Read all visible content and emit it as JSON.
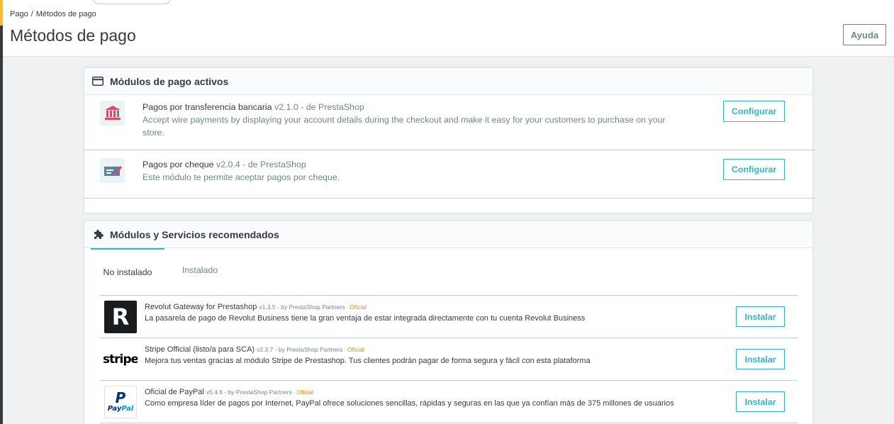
{
  "breadcrumb": {
    "items": [
      "Pago",
      "Métodos de pago"
    ],
    "separator": "/"
  },
  "page": {
    "title": "Métodos de pago",
    "help_label": "Ayuda"
  },
  "active_modules": {
    "title": "Módulos de pago activos",
    "icon": "credit-card-icon",
    "items": [
      {
        "name": "Pagos por transferencia bancaria",
        "version": "v2.1.0 - de PrestaShop",
        "description": "Accept wire payments by displaying your account details during the checkout and make it easy for your customers to purchase on your store.",
        "button": "Configurar",
        "icon": "bank-icon"
      },
      {
        "name": "Pagos por cheque",
        "version": "v2.0.4 - de PrestaShop",
        "description": "Este módulo te permite aceptar pagos por cheque.",
        "button": "Configurar",
        "icon": "cheque-icon"
      }
    ]
  },
  "recommended": {
    "title": "Módulos y Servicios recomendados",
    "icon": "puzzle-icon",
    "tabs": [
      {
        "label": "No instalado",
        "active": true
      },
      {
        "label": "Instalado",
        "active": false
      }
    ],
    "items": [
      {
        "name": "Revolut Gateway for Prestashop",
        "version": "v1.3.5 - by PrestaShop Partners",
        "separator": "-",
        "official": "Oficial",
        "description": "La pasarela de pago de Revolut Business tiene la gran ventaja de estar integrada directamente con tu cuenta Revolut Business",
        "button": "Instalar",
        "logo_letter": "R"
      },
      {
        "name": "Stripe Official (listo/a para SCA)",
        "version": "v2.3.7 - by PrestaShop Partners",
        "separator": "-",
        "official": "Oficial",
        "description": "Mejora tus ventas gracias al módulo Stripe de Prestashop. Tus clientes podrán pagar de forma segura y fácil con esta plataforma",
        "button": "Instalar",
        "logo_text": "stripe"
      },
      {
        "name": "Oficial de PayPal",
        "version": "v5.4.6 - by PrestaShop Partners",
        "separator": "-",
        "official": "Oficial",
        "description": "Como empresa líder de pagos por Internet, PayPal ofrece soluciones sencillas, rápidas y seguras en las que ya confían más de 375 millones de usuarios",
        "button": "Instalar",
        "logo_letter": "P",
        "logo_pay": "Pay",
        "logo_pal": "Pal"
      }
    ]
  },
  "colors": {
    "primary": "#25b9d7",
    "text": "#363a41",
    "muted": "#6c868e",
    "official": "#e08700",
    "background": "#eff1f2"
  }
}
